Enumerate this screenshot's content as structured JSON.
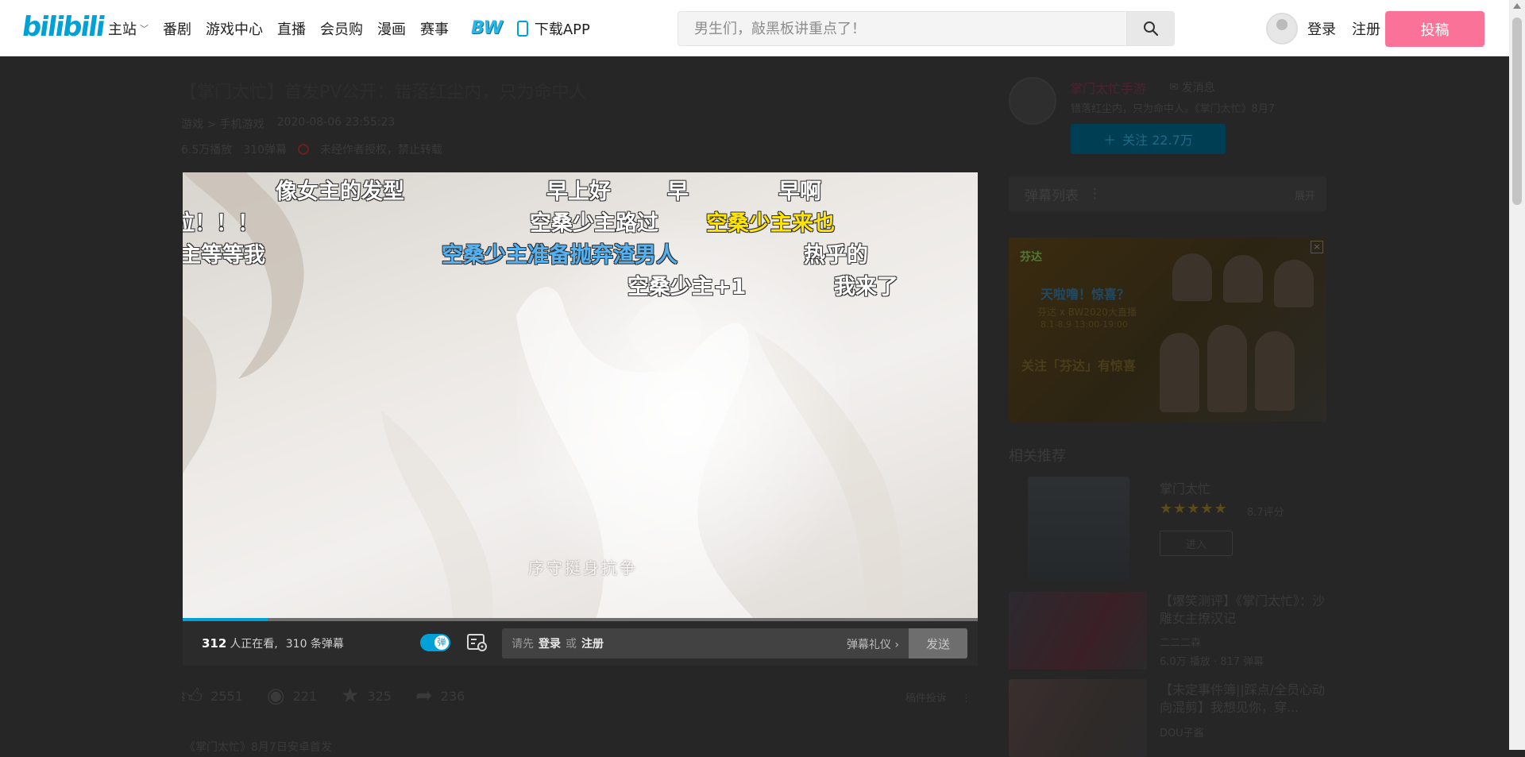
{
  "header": {
    "logo": "bilibili",
    "nav": [
      {
        "label": "主站",
        "has_dropdown": true
      },
      {
        "label": "番剧"
      },
      {
        "label": "游戏中心"
      },
      {
        "label": "直播"
      },
      {
        "label": "会员购"
      },
      {
        "label": "漫画"
      },
      {
        "label": "赛事"
      }
    ],
    "bw": "BW",
    "download": "下载APP",
    "search_placeholder": "男生们，敲黑板讲重点了！",
    "login": "登录",
    "register": "注册",
    "upload": "投稿"
  },
  "video": {
    "title": "【掌门太忙】首发PV公开：错落红尘内，只为命中人",
    "category": "游戏 > 手机游戏",
    "date": "2020-08-06 23:55:23",
    "views": "6.5万播放",
    "danmaku_count": "310弹幕",
    "copyright": "未经作者授权，禁止转载",
    "subtitle": "序守挺身抗争",
    "progress": 0.107
  },
  "danmaku": [
    {
      "text": "像女主的发型",
      "style": "white"
    },
    {
      "text": "早上好",
      "style": "white"
    },
    {
      "text": "早",
      "style": "white"
    },
    {
      "text": "早啊",
      "style": "white"
    },
    {
      "text": "拉！！！",
      "style": "white"
    },
    {
      "text": "空桑少主路过",
      "style": "white"
    },
    {
      "text": "空桑少主来也",
      "style": "yellow"
    },
    {
      "text": "主等等我",
      "style": "white"
    },
    {
      "text": "空桑少主准备抛弃渣男人",
      "style": "blue"
    },
    {
      "text": "热乎的",
      "style": "white"
    },
    {
      "text": "空桑少主+1",
      "style": "white"
    },
    {
      "text": "我来了",
      "style": "white"
    }
  ],
  "player_bar": {
    "watching_count": "312",
    "watching_label": "人正在看,",
    "danmaku_total": "310 条弹幕",
    "toggle_label": "弹",
    "prompt_prefix": "请先",
    "login": "登录",
    "or": "或",
    "register": "注册",
    "etiquette": "弹幕礼仪",
    "send": "发送"
  },
  "actions": {
    "like": "2551",
    "coin": "221",
    "favorite": "325",
    "share": "236",
    "report": "稿件投诉"
  },
  "description": "《掌门太忙》8月7日安卓首发",
  "uploader": {
    "name": "掌门太忙手游",
    "message": "发消息",
    "desc": "错落红尘内，只为命中人。《掌门太忙》8月7",
    "follow": "关注 22.7万"
  },
  "danmaku_list": {
    "title": "弹幕列表",
    "expand": "展开"
  },
  "ad": {
    "brand": "芬达",
    "line1": "天啦噜！惊喜？",
    "line2": "芬达 x BW2020大直播",
    "line3": "8.1-8.9 13:00-19:00",
    "line4": "关注「芬达」有惊喜"
  },
  "related": {
    "title": "相关推荐",
    "featured": {
      "title": "掌门太忙",
      "stars": "★★★★★",
      "score": "8.7评分",
      "enter": "进入"
    },
    "items": [
      {
        "title": "【爆笑测评】《掌门太忙》：沙雕女主撩汉记",
        "author": "二二二森",
        "stats": "6.0万 播放 · 817 弹幕"
      },
      {
        "title": "【未定事件簿||踩点/全员心动向混剪】我想见你，穿...",
        "author": "DOU子酱",
        "stats": ""
      }
    ]
  },
  "colors": {
    "accent": "#00a1d6",
    "upload": "#fb7299",
    "danmaku_yellow": "#ffe400",
    "danmaku_blue": "#54b2f2"
  }
}
